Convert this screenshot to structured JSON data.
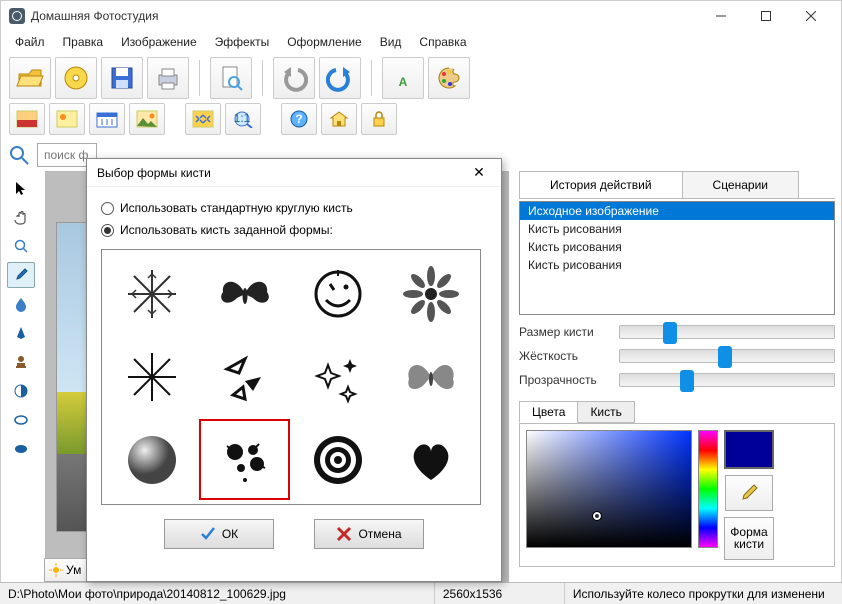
{
  "titlebar": {
    "title": "Домашняя Фотостудия"
  },
  "menu": [
    "Файл",
    "Правка",
    "Изображение",
    "Эффекты",
    "Оформление",
    "Вид",
    "Справка"
  ],
  "search": {
    "placeholder": "поиск ф"
  },
  "right": {
    "tabs": {
      "history": "История действий",
      "scenarios": "Сценарии"
    },
    "history": [
      "Исходное изображение",
      "Кисть рисования",
      "Кисть рисования",
      "Кисть рисования"
    ],
    "sliders": {
      "size": "Размер кисти",
      "hardness": "Жёсткость",
      "opacity": "Прозрачность"
    },
    "colortabs": {
      "colors": "Цвета",
      "brush": "Кисть"
    },
    "swatch": "#000099",
    "shapebtn_l1": "Форма",
    "shapebtn_l2": "кисти"
  },
  "dialog": {
    "title": "Выбор формы кисти",
    "radio_round": "Использовать стандартную круглую кисть",
    "radio_shape": "Использовать кисть заданной формы:",
    "ok": "ОК",
    "cancel": "Отмена"
  },
  "bottom_button": "Ум",
  "status": {
    "path": "D:\\Photo\\Мои фото\\природа\\20140812_100629.jpg",
    "dims": "2560x1536",
    "hint": "Используйте колесо прокрутки для изменени"
  }
}
